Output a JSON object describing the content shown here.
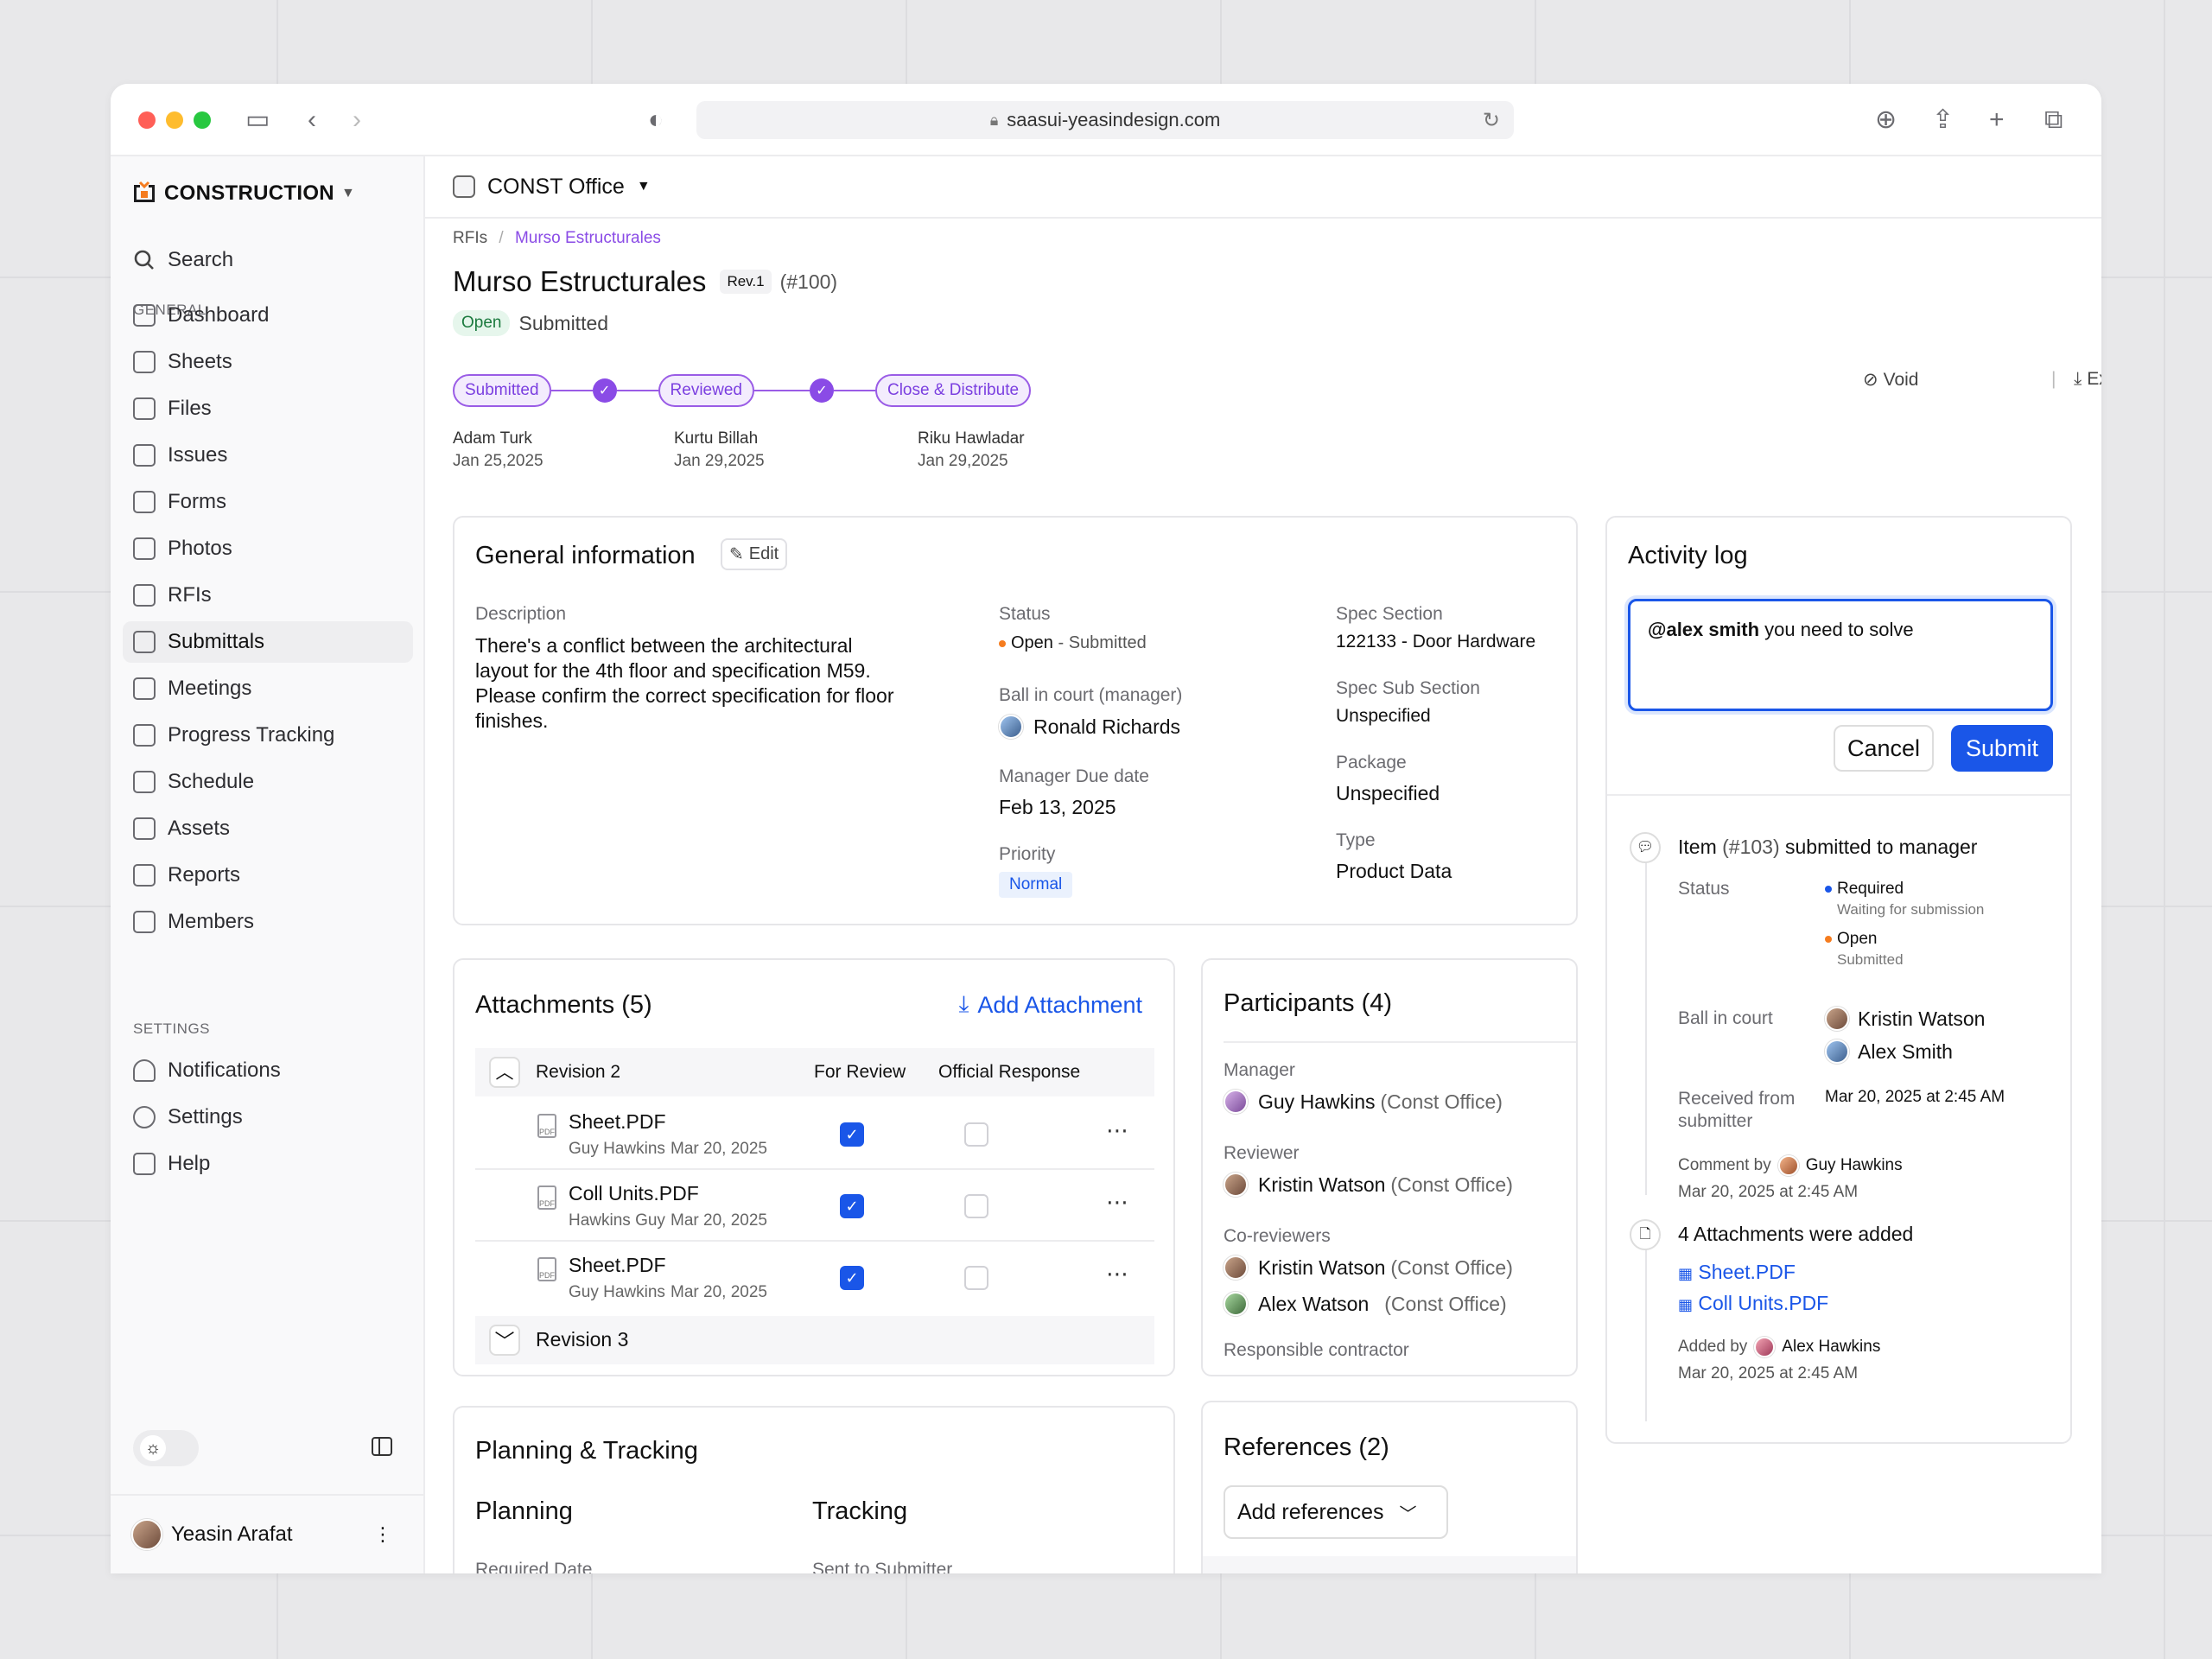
{
  "browser": {
    "url": "saasui-yeasindesign.com"
  },
  "sidebar": {
    "brand": "CONSTRUCTION",
    "search": "Search",
    "general_label": "GENERAL",
    "items": [
      "Dashboard",
      "Sheets",
      "Files",
      "Issues",
      "Forms",
      "Photos",
      "RFIs",
      "Submittals",
      "Meetings",
      "Progress Tracking",
      "Schedule",
      "Assets",
      "Reports",
      "Members"
    ],
    "settings_label": "SETTINGS",
    "settings_items": [
      "Notifications",
      "Settings",
      "Help"
    ],
    "user": "Yeasin Arafat"
  },
  "topbar": {
    "office": "CONST Office"
  },
  "breadcrumb": {
    "parent": "RFIs",
    "current": "Murso Estructurales"
  },
  "header": {
    "title": "Murso Estructurales",
    "rev": "Rev.1",
    "number": "(#100)",
    "status_badge": "Open",
    "status_text": "Submitted",
    "void": "Void",
    "export": "Export"
  },
  "workflow": {
    "steps": [
      {
        "label": "Submitted",
        "person": "Adam Turk",
        "date": "Jan 25,2025"
      },
      {
        "label": "Reviewed",
        "person": "Kurtu Billah",
        "date": "Jan 29,2025"
      },
      {
        "label": "Close & Distribute",
        "person": "Riku Hawladar",
        "date": "Jan 29,2025"
      }
    ]
  },
  "general": {
    "title": "General information",
    "edit": "Edit",
    "description_label": "Description",
    "description": "There's a conflict between the architectural layout for the 4th floor and specification M59. Please confirm the correct specification for floor finishes.",
    "status_label": "Status",
    "status_value": "Open",
    "status_sub": " - Submitted",
    "ball_label": "Ball in court (manager)",
    "ball_value": "Ronald Richards",
    "due_label": "Manager Due date",
    "due_value": "Feb 13, 2025",
    "priority_label": "Priority",
    "priority_value": "Normal",
    "spec_label": "Spec Section",
    "spec_value": "122133 - Door Hardware",
    "subsec_label": "Spec Sub Section",
    "subsec_value": "Unspecified",
    "package_label": "Package",
    "package_value": "Unspecified",
    "type_label": "Type",
    "type_value": "Product Data"
  },
  "attachments": {
    "title": "Attachments (5)",
    "add": "Add Attachment",
    "rev2": "Revision 2",
    "col_review": "For Review",
    "col_official": "Official Response",
    "rows": [
      {
        "name": "Sheet.PDF",
        "by": "Guy Hawkins",
        "date": "Mar 20, 2025"
      },
      {
        "name": "Coll Units.PDF",
        "by": "Hawkins Guy",
        "date": "Mar 20, 2025"
      },
      {
        "name": "Sheet.PDF",
        "by": "Guy Hawkins",
        "date": "Mar 20, 2025"
      }
    ],
    "rev3": "Revision 3",
    "pdf_tag": "PDF"
  },
  "participants": {
    "title": "Participants (4)",
    "manager_label": "Manager",
    "manager": "Guy Hawkins",
    "manager_org": "(Const Office)",
    "reviewer_label": "Reviewer",
    "reviewer": "Kristin Watson",
    "reviewer_org": "(Const Office)",
    "co_label": "Co-reviewers",
    "co1": "Kristin Watson",
    "co1_org": "(Const Office)",
    "co2": "Alex Watson",
    "co2_org": "(Const Office)",
    "contractor_label": "Responsible contractor"
  },
  "planning": {
    "title": "Planning & Tracking",
    "planning": "Planning",
    "tracking": "Tracking",
    "required": "Required Date",
    "sent": "Sent to Submitter"
  },
  "references": {
    "title": "References (2)",
    "add": "Add references"
  },
  "activity": {
    "title": "Activity log",
    "mention": "@alex smith",
    "message": " you need to solve",
    "cancel": "Cancel",
    "submit": "Submit",
    "item_title_a": "Item ",
    "item_num": "(#103)",
    "item_title_b": " submitted to manager",
    "status_label": "Status",
    "s1": "Required",
    "s1_sub": "Waiting for submission",
    "s2": "Open",
    "s2_sub": "Submitted",
    "ball_label": "Ball in court",
    "ball1": "Kristin Watson",
    "ball2": "Alex Smith",
    "received_label": "Received from submitter",
    "received_value": "Mar 20, 2025 at 2:45 AM",
    "comment_by": "Comment by",
    "comment_user": "Guy Hawkins",
    "comment_date": "Mar 20, 2025 at 2:45 AM",
    "attach_title": "4 Attachments were added",
    "file1": "Sheet.PDF",
    "file2": "Coll Units.PDF",
    "added_by": "Added by",
    "added_user": "Alex Hawkins",
    "added_date": "Mar 20, 2025 at 2:45 AM"
  },
  "colors": {
    "accent": "#1a56e8",
    "purple": "#8a4be6",
    "open_green": "#e6f6ec"
  }
}
